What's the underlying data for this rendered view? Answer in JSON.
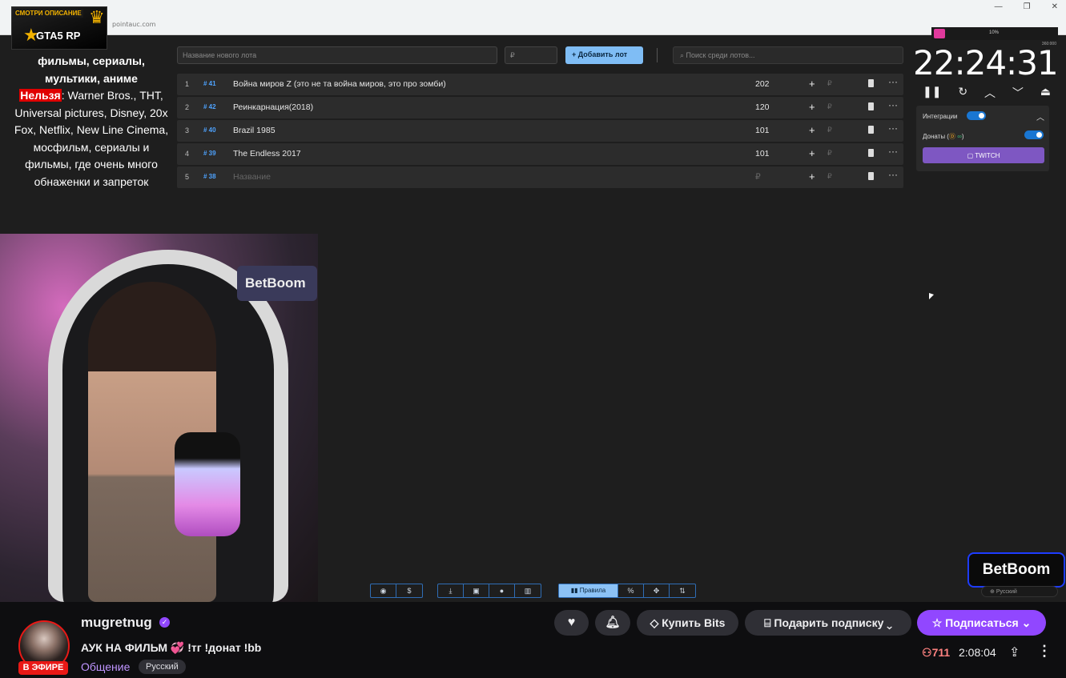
{
  "browser": {
    "url": "pointauc.com",
    "window_controls": [
      "—",
      "❐",
      "✕"
    ]
  },
  "overlay": {
    "logo_top": "СМОТРИ ОПИСАНИЕ",
    "logo_text": "GTA5 RP",
    "rules_head": "фильмы, сериалы, мультики, аниме",
    "rules_forbid": "Нельзя",
    "rules_body": ": Warner Bros., ТНТ, Universal pictures, Disney, 20x Fox, Netflix, New Line Cinema, мосфильм, сериалы и фильмы, где очень много обнаженки и запреток"
  },
  "auction": {
    "lot_placeholder": "Название нового лота",
    "price_placeholder": "₽",
    "add_lot_label": "+ Добавить лот",
    "search_placeholder": "Поиск среди лотов...",
    "lots": [
      {
        "num": "1",
        "id": "# 41",
        "name": "Война миров Z (это не та война миров, это про зомби)",
        "amount": "202"
      },
      {
        "num": "2",
        "id": "# 42",
        "name": "Реинкарнация(2018)",
        "amount": "120"
      },
      {
        "num": "3",
        "id": "# 40",
        "name": "Brazil 1985",
        "amount": "101"
      },
      {
        "num": "4",
        "id": "# 39",
        "name": "The Endless 2017",
        "amount": "101"
      },
      {
        "num": "5",
        "id": "# 38",
        "name": "Название",
        "amount": "₽"
      }
    ],
    "timer": "22:24:31",
    "slider_percent": "10%",
    "slider_max": "360:000",
    "integrations_label": "Интеграции",
    "donations_label": "Донаты (",
    "donations_suffix": ")",
    "twitch_label": "TWITCH",
    "toolbar_active_label": "Правила",
    "lang_mini": "Русский"
  },
  "webcam": {
    "sign": "BetBoom"
  },
  "sponsor": {
    "corner_logo": "BetBoom"
  },
  "channel": {
    "name": "mugretnug",
    "title": "АУК НА ФИЛЬМ 💞 !тг !донат !bb",
    "category": "Общение",
    "language": "Русский",
    "live_label": "В ЭФИРЕ",
    "viewers": "711",
    "uptime": "2:08:04"
  },
  "actions": {
    "bits_label": "Купить Bits",
    "gift_label": "Подарить подписку",
    "subscribe_label": "Подписаться"
  },
  "colors": {
    "accent": "#9147ff",
    "live": "#e91916",
    "auction_blue": "#7fbdf5",
    "viewers": "#ff8280"
  }
}
